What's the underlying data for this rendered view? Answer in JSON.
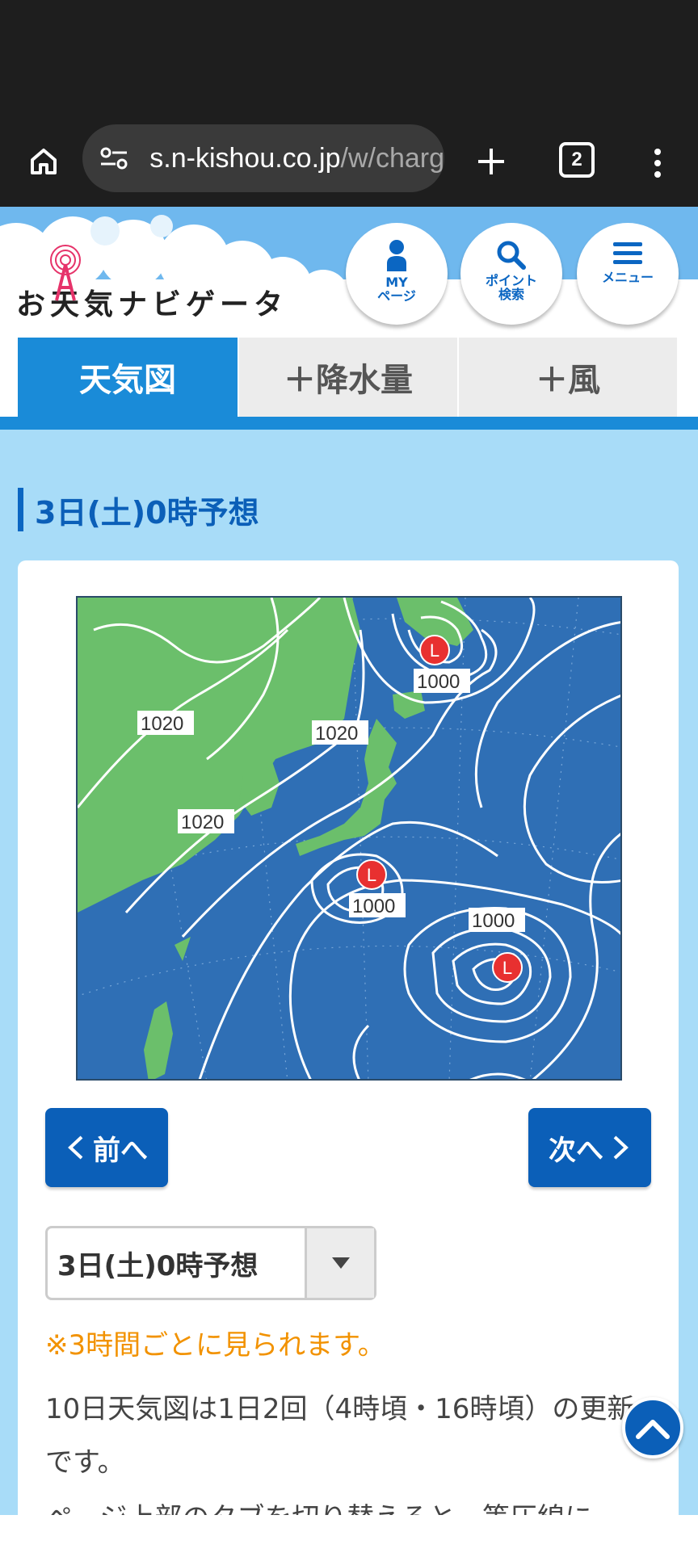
{
  "browser": {
    "url_host": "s.n-kishou.co.jp",
    "url_path": "/w/charg",
    "tab_count": "2"
  },
  "site": {
    "logo_text": "お天気ナビゲータ",
    "header_buttons": {
      "my_page": "MY\nページ",
      "point_search": "ポイント\n検索",
      "menu": "メニュー"
    }
  },
  "tabs": [
    {
      "label": "天気図",
      "active": true
    },
    {
      "label": "＋降水量",
      "active": false
    },
    {
      "label": "＋風",
      "active": false
    }
  ],
  "section_title": "3日(土)0時予想",
  "map": {
    "pressure_labels": [
      "1020",
      "1020",
      "1020",
      "1000",
      "1000",
      "1000"
    ],
    "low_marker": "L",
    "colors": {
      "sea": "#2f6fb5",
      "land": "#6bbf6b",
      "isobar": "#ffffff",
      "low": "#e83030"
    }
  },
  "nav": {
    "prev_label": "前へ",
    "next_label": "次へ"
  },
  "select": {
    "selected": "3日(土)0時予想"
  },
  "note": "※3時間ごとに見られます。",
  "description": "10日天気図は1日2回（4時頃・16時頃）の更新です。",
  "description_clipped": "ページ上部のタブを切り替えると、等圧線に"
}
